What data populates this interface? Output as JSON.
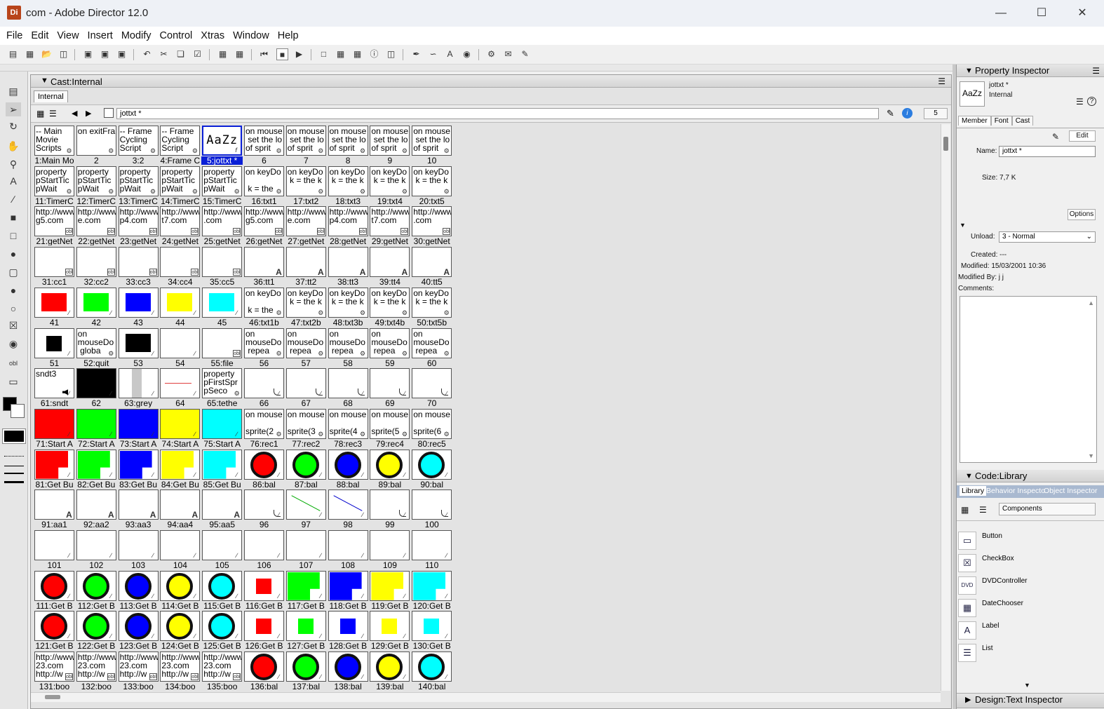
{
  "window": {
    "title": "com - Adobe Director 12.0",
    "icon_label": "Di"
  },
  "menu": [
    "File",
    "Edit",
    "View",
    "Insert",
    "Modify",
    "Control",
    "Xtras",
    "Window",
    "Help"
  ],
  "cast": {
    "title": "Cast:Internal",
    "tab": "Internal",
    "member_name": "jottxt *",
    "member_number": "5",
    "cells": [
      {
        "thumb": "-- Main\nMovie\nScripts",
        "cap": "1:Main Mo",
        "kind": "script"
      },
      {
        "thumb": "on exitFra",
        "cap": "2",
        "kind": "script"
      },
      {
        "thumb": "-- Frame\nCycling\nScript",
        "cap": "3:2",
        "kind": "script"
      },
      {
        "thumb": "-- Frame\nCycling\nScript",
        "cap": "4:Frame C",
        "kind": "script"
      },
      {
        "thumb": "AaZz",
        "cap": "5:jottxt *",
        "kind": "text",
        "selected": true
      },
      {
        "thumb": "on mouse\n set the lo\nof sprit",
        "cap": "6",
        "kind": "script"
      },
      {
        "thumb": "on mouse\n set the lo\nof sprit",
        "cap": "7",
        "kind": "script"
      },
      {
        "thumb": "on mouse\n set the lo\nof sprit",
        "cap": "8",
        "kind": "script"
      },
      {
        "thumb": "on mouse\n set the lo\nof sprit",
        "cap": "9",
        "kind": "script"
      },
      {
        "thumb": "on mouse\n set the lo\nof sprit",
        "cap": "10",
        "kind": "script"
      },
      {
        "thumb": "property\npStartTic\npWait",
        "cap": "11:TimerC",
        "kind": "script"
      },
      {
        "thumb": "property\npStartTic\npWait",
        "cap": "12:TimerC",
        "kind": "script"
      },
      {
        "thumb": "property\npStartTic\npWait",
        "cap": "13:TimerC",
        "kind": "script"
      },
      {
        "thumb": "property\npStartTic\npWait",
        "cap": "14:TimerC",
        "kind": "script"
      },
      {
        "thumb": "property\npStartTic\npWait",
        "cap": "15:TimerC",
        "kind": "script"
      },
      {
        "thumb": "on keyDo\n\n k = the",
        "cap": "16:txt1",
        "kind": "script"
      },
      {
        "thumb": "on keyDo\n k = the k",
        "cap": "17:txt2",
        "kind": "script"
      },
      {
        "thumb": "on keyDo\n k = the k",
        "cap": "18:txt3",
        "kind": "script"
      },
      {
        "thumb": "on keyDo\n k = the k",
        "cap": "19:txt4",
        "kind": "script"
      },
      {
        "thumb": "on keyDo\n k = the k",
        "cap": "20:txt5",
        "kind": "script"
      },
      {
        "thumb": "http://www\ng5.com",
        "cap": "21:getNet",
        "kind": "field"
      },
      {
        "thumb": "http://www\ne.com",
        "cap": "22:getNet",
        "kind": "field"
      },
      {
        "thumb": "http://www\np4.com",
        "cap": "23:getNet",
        "kind": "field"
      },
      {
        "thumb": "http://www\nt7.com",
        "cap": "24:getNet",
        "kind": "field"
      },
      {
        "thumb": "http://www\n.com",
        "cap": "25:getNet",
        "kind": "field"
      },
      {
        "thumb": "http://www\ng5.com",
        "cap": "26:getNet",
        "kind": "field"
      },
      {
        "thumb": "http://www\ne.com",
        "cap": "27:getNet",
        "kind": "field"
      },
      {
        "thumb": "http://www\np4.com",
        "cap": "28:getNet",
        "kind": "field"
      },
      {
        "thumb": "http://www\nt7.com",
        "cap": "29:getNet",
        "kind": "field"
      },
      {
        "thumb": "http://www\n.com",
        "cap": "30:getNet",
        "kind": "field"
      },
      {
        "thumb": "",
        "cap": "31:cc1",
        "kind": "field"
      },
      {
        "thumb": "",
        "cap": "32:cc2",
        "kind": "field"
      },
      {
        "thumb": "",
        "cap": "33:cc3",
        "kind": "field"
      },
      {
        "thumb": "",
        "cap": "34:cc4",
        "kind": "field"
      },
      {
        "thumb": "",
        "cap": "35:cc5",
        "kind": "field"
      },
      {
        "thumb": "",
        "cap": "36:tt1",
        "kind": "textA"
      },
      {
        "thumb": "",
        "cap": "37:tt2",
        "kind": "textA"
      },
      {
        "thumb": "",
        "cap": "38:tt3",
        "kind": "textA"
      },
      {
        "thumb": "",
        "cap": "39:tt4",
        "kind": "textA"
      },
      {
        "thumb": "",
        "cap": "40:tt5",
        "kind": "textA"
      },
      {
        "thumb": "",
        "cap": "41",
        "kind": "rect",
        "color": "#ff0000"
      },
      {
        "thumb": "",
        "cap": "42",
        "kind": "rect",
        "color": "#00ff00"
      },
      {
        "thumb": "",
        "cap": "43",
        "kind": "rect",
        "color": "#0000ff"
      },
      {
        "thumb": "",
        "cap": "44",
        "kind": "rect",
        "color": "#ffff00"
      },
      {
        "thumb": "",
        "cap": "45",
        "kind": "rect",
        "color": "#00ffff"
      },
      {
        "thumb": "on keyDo\n\n k = the",
        "cap": "46:txt1b",
        "kind": "script"
      },
      {
        "thumb": "on keyDo\n k = the k",
        "cap": "47:txt2b",
        "kind": "script"
      },
      {
        "thumb": "on keyDo\n k = the k",
        "cap": "48:txt3b",
        "kind": "script"
      },
      {
        "thumb": "on keyDo\n k = the k",
        "cap": "49:txt4b",
        "kind": "script"
      },
      {
        "thumb": "on keyDo\n k = the k",
        "cap": "50:txt5b",
        "kind": "script"
      },
      {
        "thumb": "",
        "cap": "51",
        "kind": "smallsq",
        "color": "#000000"
      },
      {
        "thumb": "on\nmouseDo\n globa",
        "cap": "52:quit",
        "kind": "script"
      },
      {
        "thumb": "",
        "cap": "53",
        "kind": "rect",
        "color": "#000000"
      },
      {
        "thumb": "",
        "cap": "54",
        "kind": "blank"
      },
      {
        "thumb": "",
        "cap": "55:file",
        "kind": "field"
      },
      {
        "thumb": "on\nmouseDo\n repea",
        "cap": "56",
        "kind": "script"
      },
      {
        "thumb": "on\nmouseDo\n repea",
        "cap": "57",
        "kind": "script"
      },
      {
        "thumb": "on\nmouseDo\n repea",
        "cap": "58",
        "kind": "script"
      },
      {
        "thumb": "on\nmouseDo\n repea",
        "cap": "59",
        "kind": "script"
      },
      {
        "thumb": "on\nmouseDo\n repea",
        "cap": "60",
        "kind": "script"
      },
      {
        "thumb": "sndt3",
        "cap": "61:sndt",
        "kind": "sound"
      },
      {
        "thumb": "",
        "cap": "62",
        "kind": "full",
        "color": "#000000"
      },
      {
        "thumb": "",
        "cap": "63:grey",
        "kind": "greybar"
      },
      {
        "thumb": "",
        "cap": "64",
        "kind": "redline"
      },
      {
        "thumb": "property\npFirstSpr\npSeco",
        "cap": "65:tethe",
        "kind": "script"
      },
      {
        "thumb": "",
        "cap": "66",
        "kind": "shape"
      },
      {
        "thumb": "",
        "cap": "67",
        "kind": "shape"
      },
      {
        "thumb": "",
        "cap": "68",
        "kind": "shape"
      },
      {
        "thumb": "",
        "cap": "69",
        "kind": "shape"
      },
      {
        "thumb": "",
        "cap": "70",
        "kind": "shape"
      },
      {
        "thumb": "",
        "cap": "71:Start A",
        "kind": "full",
        "color": "#ff0000"
      },
      {
        "thumb": "",
        "cap": "72:Start A",
        "kind": "full",
        "color": "#00ff00"
      },
      {
        "thumb": "",
        "cap": "73:Start A",
        "kind": "full",
        "color": "#0000ff"
      },
      {
        "thumb": "",
        "cap": "74:Start A",
        "kind": "full",
        "color": "#ffff00"
      },
      {
        "thumb": "",
        "cap": "75:Start A",
        "kind": "full",
        "color": "#00ffff"
      },
      {
        "thumb": "on mouse\n\nsprite(2",
        "cap": "76:rec1",
        "kind": "script"
      },
      {
        "thumb": "on mouse\n\nsprite(3",
        "cap": "77:rec2",
        "kind": "script"
      },
      {
        "thumb": "on mouse\n\nsprite(4",
        "cap": "78:rec3",
        "kind": "script"
      },
      {
        "thumb": "on mouse\n\nsprite(5",
        "cap": "79:rec4",
        "kind": "script"
      },
      {
        "thumb": "on mouse\n\nsprite(6",
        "cap": "80:rec5",
        "kind": "script"
      },
      {
        "thumb": "",
        "cap": "81:Get Bu",
        "kind": "rectbig",
        "color": "#ff0000"
      },
      {
        "thumb": "",
        "cap": "82:Get Bu",
        "kind": "rectbig",
        "color": "#00ff00"
      },
      {
        "thumb": "",
        "cap": "83:Get Bu",
        "kind": "rectbig",
        "color": "#0000ff"
      },
      {
        "thumb": "",
        "cap": "84:Get Bu",
        "kind": "rectbig",
        "color": "#ffff00"
      },
      {
        "thumb": "",
        "cap": "85:Get Bu",
        "kind": "rectbig",
        "color": "#00ffff"
      },
      {
        "thumb": "",
        "cap": "86:bal",
        "kind": "ball",
        "color": "#ff0000"
      },
      {
        "thumb": "",
        "cap": "87:bal",
        "kind": "ball",
        "color": "#00ff00"
      },
      {
        "thumb": "",
        "cap": "88:bal",
        "kind": "ball",
        "color": "#0000ff"
      },
      {
        "thumb": "",
        "cap": "89:bal",
        "kind": "ball",
        "color": "#ffff00"
      },
      {
        "thumb": "",
        "cap": "90:bal",
        "kind": "ball",
        "color": "#00ffff"
      },
      {
        "thumb": "",
        "cap": "91:aa1",
        "kind": "textA"
      },
      {
        "thumb": "",
        "cap": "92:aa2",
        "kind": "textA"
      },
      {
        "thumb": "",
        "cap": "93:aa3",
        "kind": "textA"
      },
      {
        "thumb": "",
        "cap": "94:aa4",
        "kind": "textA"
      },
      {
        "thumb": "",
        "cap": "95:aa5",
        "kind": "textA"
      },
      {
        "thumb": "",
        "cap": "96",
        "kind": "shape"
      },
      {
        "thumb": "",
        "cap": "97",
        "kind": "greenline"
      },
      {
        "thumb": "",
        "cap": "98",
        "kind": "blueline"
      },
      {
        "thumb": "",
        "cap": "99",
        "kind": "shape"
      },
      {
        "thumb": "",
        "cap": "100",
        "kind": "shape"
      },
      {
        "thumb": "",
        "cap": "101",
        "kind": "blank"
      },
      {
        "thumb": "",
        "cap": "102",
        "kind": "blank"
      },
      {
        "thumb": "",
        "cap": "103",
        "kind": "blank"
      },
      {
        "thumb": "",
        "cap": "104",
        "kind": "blank"
      },
      {
        "thumb": "",
        "cap": "105",
        "kind": "blank"
      },
      {
        "thumb": "",
        "cap": "106",
        "kind": "blank"
      },
      {
        "thumb": "",
        "cap": "107",
        "kind": "blank"
      },
      {
        "thumb": "",
        "cap": "108",
        "kind": "blank"
      },
      {
        "thumb": "",
        "cap": "109",
        "kind": "blank"
      },
      {
        "thumb": "",
        "cap": "110",
        "kind": "blank"
      },
      {
        "thumb": "",
        "cap": "111:Get B",
        "kind": "ball",
        "color": "#ff0000"
      },
      {
        "thumb": "",
        "cap": "112:Get B",
        "kind": "ball",
        "color": "#00ff00"
      },
      {
        "thumb": "",
        "cap": "113:Get B",
        "kind": "ball",
        "color": "#0000ff"
      },
      {
        "thumb": "",
        "cap": "114:Get B",
        "kind": "ball",
        "color": "#ffff00"
      },
      {
        "thumb": "",
        "cap": "115:Get B",
        "kind": "ball",
        "color": "#00ffff"
      },
      {
        "thumb": "",
        "cap": "116:Get B",
        "kind": "smallsq",
        "color": "#ff0000"
      },
      {
        "thumb": "",
        "cap": "117:Get B",
        "kind": "rectbig",
        "color": "#00ff00"
      },
      {
        "thumb": "",
        "cap": "118:Get B",
        "kind": "rectbig",
        "color": "#0000ff"
      },
      {
        "thumb": "",
        "cap": "119:Get B",
        "kind": "rectbig",
        "color": "#ffff00"
      },
      {
        "thumb": "",
        "cap": "120:Get B",
        "kind": "rectbig",
        "color": "#00ffff"
      },
      {
        "thumb": "",
        "cap": "121:Get B",
        "kind": "ball",
        "color": "#ff0000"
      },
      {
        "thumb": "",
        "cap": "122:Get B",
        "kind": "ball",
        "color": "#00ff00"
      },
      {
        "thumb": "",
        "cap": "123:Get B",
        "kind": "ball",
        "color": "#0000ff"
      },
      {
        "thumb": "",
        "cap": "124:Get B",
        "kind": "ball",
        "color": "#ffff00"
      },
      {
        "thumb": "",
        "cap": "125:Get B",
        "kind": "ball",
        "color": "#00ffff"
      },
      {
        "thumb": "",
        "cap": "126:Get B",
        "kind": "smallsq",
        "color": "#ff0000"
      },
      {
        "thumb": "",
        "cap": "127:Get B",
        "kind": "smallsq",
        "color": "#00ff00"
      },
      {
        "thumb": "",
        "cap": "128:Get B",
        "kind": "smallsq",
        "color": "#0000ff"
      },
      {
        "thumb": "",
        "cap": "129:Get B",
        "kind": "smallsq",
        "color": "#ffff00"
      },
      {
        "thumb": "",
        "cap": "130:Get B",
        "kind": "smallsq",
        "color": "#00ffff"
      },
      {
        "thumb": "http://www\n23.com\nhttp://w",
        "cap": "131:boo",
        "kind": "field"
      },
      {
        "thumb": "http://www\n23.com\nhttp://w",
        "cap": "132:boo",
        "kind": "field"
      },
      {
        "thumb": "http://www\n23.com\nhttp://w",
        "cap": "133:boo",
        "kind": "field"
      },
      {
        "thumb": "http://www\n23.com\nhttp://w",
        "cap": "134:boo",
        "kind": "field"
      },
      {
        "thumb": "http://www\n23.com\nhttp://w",
        "cap": "135:boo",
        "kind": "field"
      },
      {
        "thumb": "",
        "cap": "136:bal",
        "kind": "ball",
        "color": "#ff0000"
      },
      {
        "thumb": "",
        "cap": "137:bal",
        "kind": "ball",
        "color": "#00ff00"
      },
      {
        "thumb": "",
        "cap": "138:bal",
        "kind": "ball",
        "color": "#0000ff"
      },
      {
        "thumb": "",
        "cap": "139:bal",
        "kind": "ball",
        "color": "#ffff00"
      },
      {
        "thumb": "",
        "cap": "140:bal",
        "kind": "ball",
        "color": "#00ffff"
      }
    ]
  },
  "property_inspector": {
    "title": "Property Inspector",
    "member_name": "jottxt *",
    "member_cast": "Internal",
    "tabs": [
      "Member",
      "Font",
      "Cast"
    ],
    "edit_label": "Edit",
    "name_label": "Name:",
    "name_value": "jottxt *",
    "size": "Size: 7,7 K",
    "options_label": "Options",
    "unload_label": "Unload:",
    "unload_value": "3 - Normal",
    "created": "Created: ---",
    "modified": "Modified: 15/03/2001 10:36",
    "modified_by": "Modified By: j j",
    "comments_label": "Comments:"
  },
  "library": {
    "title": "Code:Library",
    "tabs": [
      "Library",
      "Behavior Inspecto",
      "Object Inspector"
    ],
    "category": "Components",
    "items": [
      {
        "label": "Button",
        "icon": "button-icon"
      },
      {
        "label": "CheckBox",
        "icon": "checkbox-icon"
      },
      {
        "label": "DVDController",
        "icon": "dvd-icon"
      },
      {
        "label": "DateChooser",
        "icon": "calendar-icon"
      },
      {
        "label": "Label",
        "icon": "label-icon"
      },
      {
        "label": "List",
        "icon": "list-icon"
      }
    ],
    "footer": "Design:Text Inspector"
  }
}
